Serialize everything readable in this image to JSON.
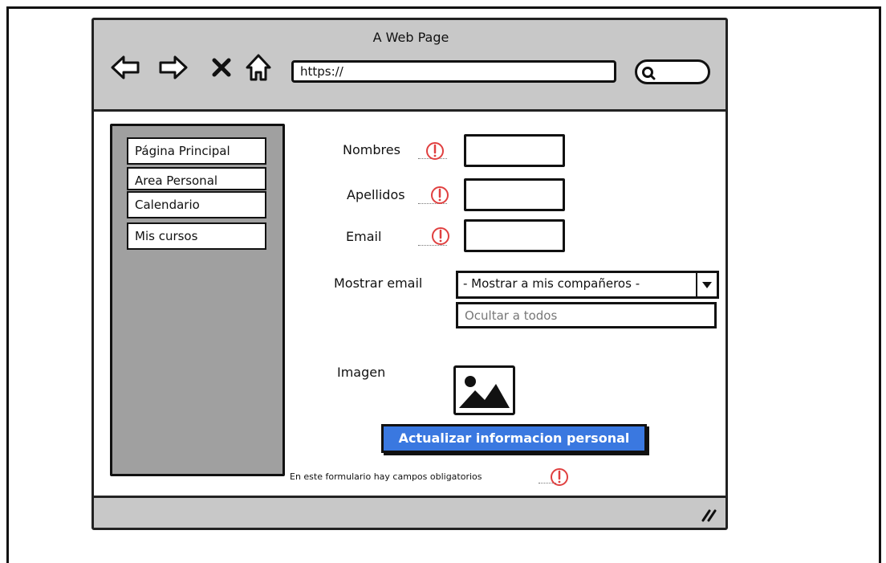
{
  "window": {
    "title": "A Web Page",
    "url": "https://"
  },
  "sidebar": {
    "items": [
      {
        "label": "Página Principal"
      },
      {
        "label": "Area Personal"
      },
      {
        "label": "Calendario"
      },
      {
        "label": "Mis cursos"
      }
    ]
  },
  "form": {
    "nombres_label": "Nombres",
    "apellidos_label": "Apellidos",
    "email_label": "Email",
    "mostrar_email_label": "Mostrar email",
    "mostrar_email_selected": "- Mostrar a mis compañeros -",
    "mostrar_email_option": "Ocultar a todos",
    "imagen_label": "Imagen",
    "update_button": "Actualizar informacion personal",
    "required_note": "En este formulario hay campos obligatorios"
  },
  "colors": {
    "chrome_gray": "#c8c8c8",
    "sidebar_gray": "#a0a0a0",
    "button_blue": "#3a78e0",
    "warning_red": "#e04040"
  },
  "icons": {
    "back": "back-arrow-icon",
    "forward": "forward-arrow-icon",
    "stop": "stop-x-icon",
    "home": "home-icon",
    "search": "search-icon",
    "warning": "warning-icon",
    "image": "image-placeholder-icon",
    "dropdown": "chevron-down-icon",
    "resize": "resize-grip-icon"
  }
}
